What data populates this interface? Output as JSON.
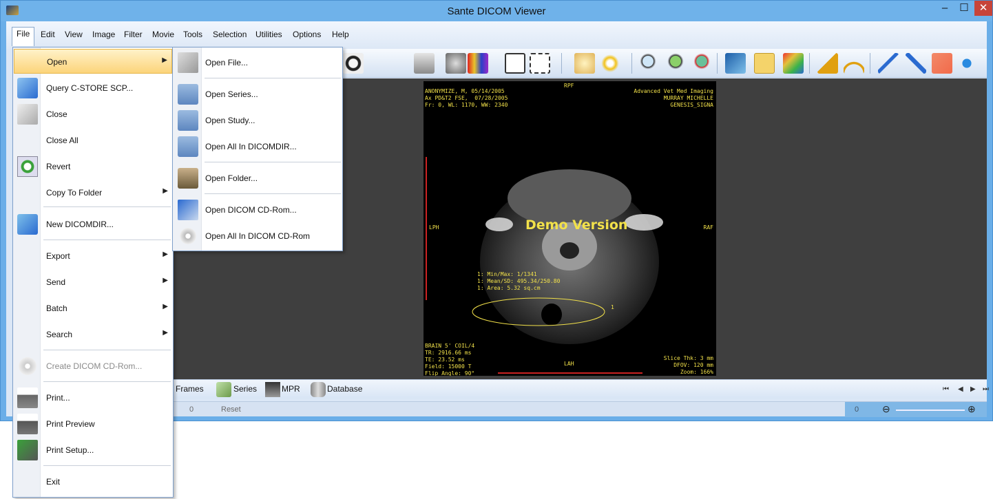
{
  "window": {
    "title": "Sante DICOM Viewer"
  },
  "titlebar_buttons": {
    "minimize": "–",
    "maximize": "☐",
    "close": "✕"
  },
  "menubar": [
    "File",
    "Edit",
    "View",
    "Image",
    "Filter",
    "Movie",
    "Tools",
    "Selection",
    "Utilities",
    "Options",
    "Help"
  ],
  "file_menu": [
    {
      "label": "Open",
      "arrow": "▶",
      "icon": "open-icon"
    },
    {
      "label": "Query C-STORE SCP...",
      "icon": "network-computer-icon"
    },
    {
      "label": "Close",
      "icon": "close-file-icon"
    },
    {
      "label": "Close All"
    },
    {
      "label": "Revert",
      "icon": "revert-icon"
    },
    {
      "label": "Copy To Folder",
      "arrow": "▶"
    },
    {
      "label": "New DICOMDIR...",
      "icon": "new-dicomdir-icon"
    },
    {
      "label": "Export",
      "arrow": "▶"
    },
    {
      "label": "Send",
      "arrow": "▶"
    },
    {
      "label": "Batch",
      "arrow": "▶"
    },
    {
      "label": "Search",
      "arrow": "▶"
    },
    {
      "label": "Create DICOM CD-Rom...",
      "icon": "cd-icon",
      "disabled": true
    },
    {
      "label": "Print...",
      "icon": "printer-icon"
    },
    {
      "label": "Print Preview",
      "icon": "print-preview-icon"
    },
    {
      "label": "Print Setup...",
      "icon": "print-setup-icon"
    },
    {
      "label": "Exit"
    }
  ],
  "open_submenu": [
    {
      "label": "Open File...",
      "icon": "open-file-icon"
    },
    {
      "label": "Open Series...",
      "icon": "folder-icon"
    },
    {
      "label": "Open Study...",
      "icon": "folder-icon"
    },
    {
      "label": "Open All In DICOMDIR...",
      "icon": "dicomdir-folder-icon"
    },
    {
      "label": "Open Folder...",
      "icon": "open-folder-icon"
    },
    {
      "label": "Open DICOM CD-Rom...",
      "icon": "cd-rom-icon"
    },
    {
      "label": "Open All In DICOM CD-Rom",
      "icon": "cd-rom-person-icon"
    }
  ],
  "image_overlay": {
    "top_left": "ANONYMIZE, M, 05/14/2005\nAx PD&T2 FSE,  07/28/2005\nFr: 0, WL: 1170, WW: 2340",
    "top_center": "RPF",
    "top_right": "Advanced Vet Med Imaging\nMURRAY MICHELLE\nGENESIS_SIGNA",
    "left_mid": "LPH",
    "right_mid": "RAF",
    "bottom_center": "LAH",
    "bottom_left": "BRAIN 5' COIL/4\nTR: 2916.66 ms\nTE: 23.52 ms\nField: 15000 T\nFlip Angle: 90°",
    "bottom_right": "Slice Thk: 3 mm\nDFOV: 120 mm\nZoom: 166%",
    "roi_stats": "1: Min/Max: 1/1341\n1: Mean/SD: 495.34/250.80\n1: Area: 5.32 sq.cm",
    "roi_label": "1",
    "watermark": "Demo Version"
  },
  "bottom_tabs": {
    "frames": "Frames",
    "series": "Series",
    "mpr": "MPR",
    "database": "Database"
  },
  "nav_buttons": {
    "first": "⏮",
    "prev": "◀",
    "next": "▶",
    "last": "⏭"
  },
  "status": {
    "frame": "0",
    "reset": "Reset",
    "zoom_value": "0",
    "zoom_minus": "⊖",
    "zoom_plus": "⊕"
  },
  "colors": {
    "titlebar": "#6fb2ea",
    "menu_highlight": "#fcd47a",
    "overlay_text": "#f2e14a",
    "viewport_bg": "#3f3f3f"
  }
}
